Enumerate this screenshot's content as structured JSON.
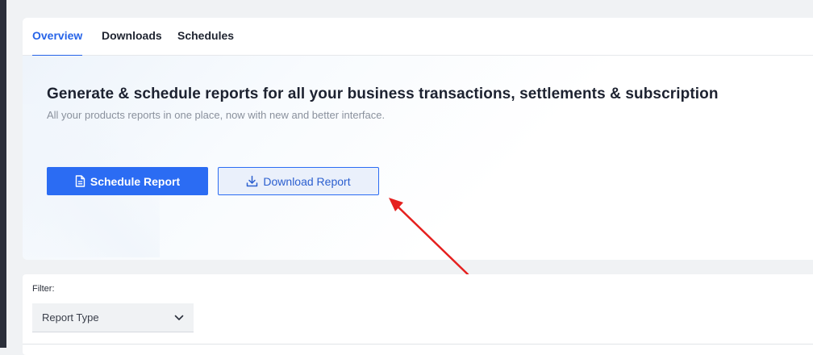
{
  "tabs": [
    {
      "label": "Overview",
      "active": true
    },
    {
      "label": "Downloads",
      "active": false
    },
    {
      "label": "Schedules",
      "active": false
    }
  ],
  "hero": {
    "title": "Generate & schedule reports for all your business transactions, settlements & subscription",
    "subtitle": "All your products reports in one place, now with new and better interface."
  },
  "buttons": {
    "schedule_label": "Schedule Report",
    "schedule_icon": "document-icon",
    "download_label": "Download Report",
    "download_icon": "download-icon"
  },
  "filter": {
    "label": "Filter:",
    "select_value": "Report Type",
    "select_icon": "chevron-down-icon"
  },
  "colors": {
    "accent": "#2b6cf3",
    "annotation_arrow": "#e5201f"
  }
}
